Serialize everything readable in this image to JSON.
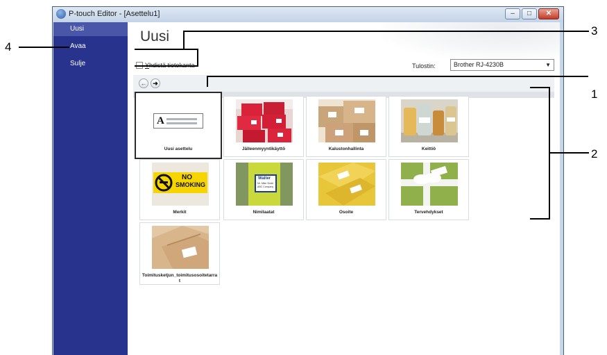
{
  "window": {
    "title": "P-touch Editor - [Asettelu1]",
    "minimize_glyph": "–",
    "maximize_glyph": "□",
    "close_glyph": "✕"
  },
  "nav": {
    "items": [
      {
        "label": "Uusi",
        "selected": true
      },
      {
        "label": "Avaa",
        "selected": false
      },
      {
        "label": "Sulje",
        "selected": false
      }
    ]
  },
  "main": {
    "title": "Uusi",
    "db_checkbox": {
      "label_underlined": "Y",
      "label_rest": "hdistä tietokanta",
      "checked": false
    },
    "printer": {
      "label": "Tulostin:",
      "value": "Brother RJ-4230B"
    },
    "back_glyph": "←",
    "forward_glyph": "➜"
  },
  "templates": [
    {
      "label": "Uusi asettelu",
      "selected": true,
      "icon": "new-layout-thumbnail"
    },
    {
      "label": "Jälleenmyyntikäyttö",
      "selected": false,
      "icon": "retail-boxes-thumbnail"
    },
    {
      "label": "Kalustonhallinta",
      "selected": false,
      "icon": "asset-boxes-thumbnail"
    },
    {
      "label": "Keittiö",
      "selected": false,
      "icon": "kitchen-jars-thumbnail"
    },
    {
      "label": "Merkit",
      "selected": false,
      "icon": "no-smoking-sign-thumbnail"
    },
    {
      "label": "Nimilaatat",
      "selected": false,
      "icon": "name-badge-thumbnail"
    },
    {
      "label": "Osoite",
      "selected": false,
      "icon": "address-envelopes-thumbnail"
    },
    {
      "label": "Tervehdykset",
      "selected": false,
      "icon": "gift-ribbon-thumbnail"
    },
    {
      "label": "Toimitusketjun_toimitusosoitetarrat",
      "selected": false,
      "icon": "shipping-box-thumbnail"
    }
  ],
  "thumb_text": {
    "new_layout_letter": "A",
    "no_smoking_line1": "NO",
    "no_smoking_line2": "SMOKING",
    "badge_name": "Walter",
    "badge_line2": "Mr. Mike Smith",
    "badge_line3": "ABC Company"
  },
  "callouts": {
    "one": "1",
    "two": "2",
    "three": "3",
    "four": "4"
  },
  "colors": {
    "nav_background": "#27338d",
    "nav_selected": "#4a56a8",
    "window_frame": "#c7d6e8",
    "close_button": "#c53a26"
  }
}
